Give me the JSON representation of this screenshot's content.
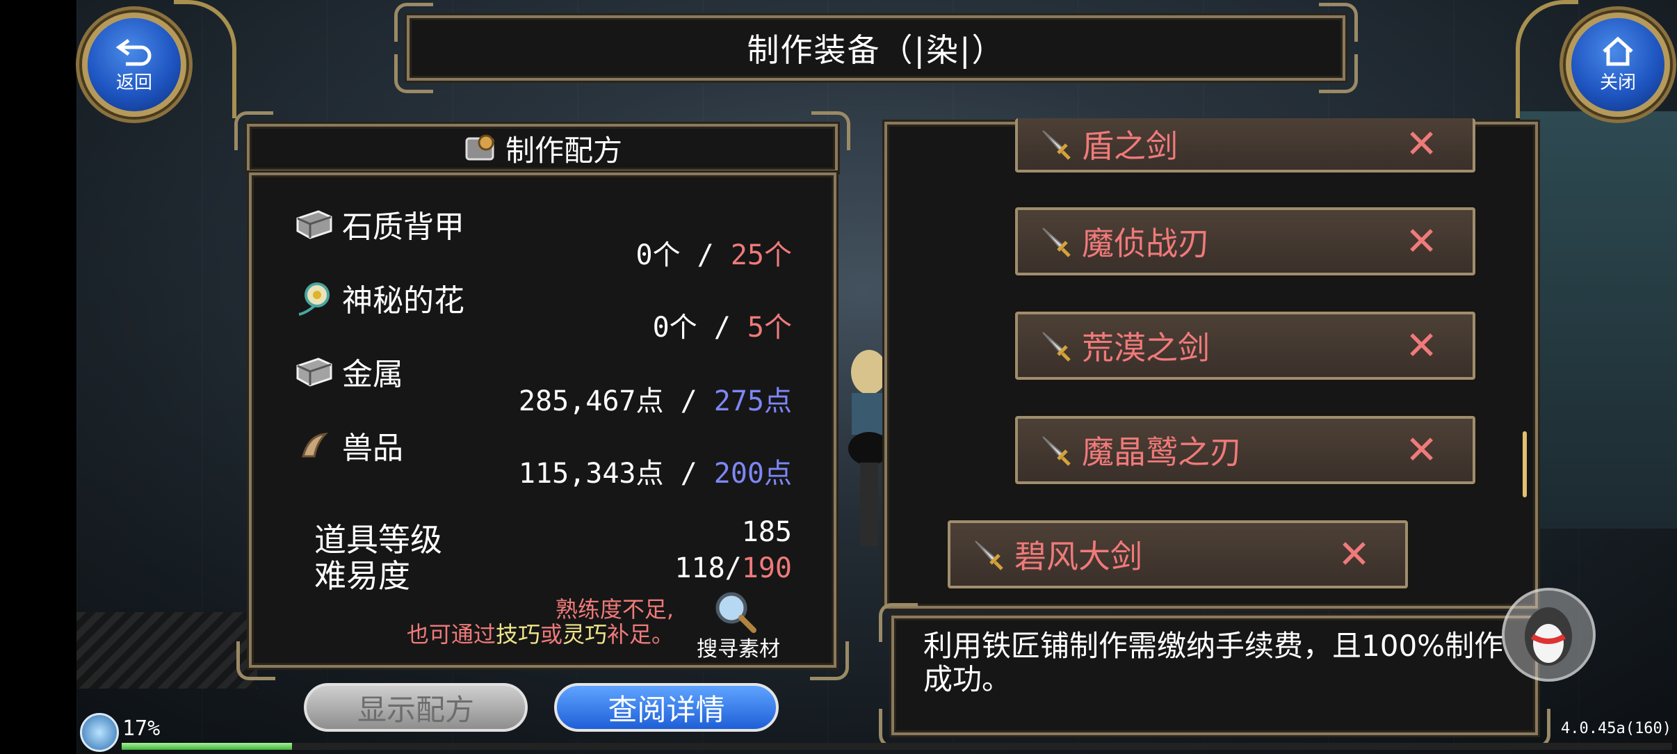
{
  "title": "制作装备（|染|）",
  "buttons": {
    "back": {
      "label": "返回",
      "icon": "back-arrow-icon"
    },
    "close": {
      "label": "关闭",
      "icon": "home-icon"
    },
    "show_recipe": "显示配方",
    "view_detail": "查阅详情",
    "search_material": "搜寻素材"
  },
  "recipe": {
    "header": "制作配方",
    "materials": [
      {
        "name": "石质背甲",
        "icon": "stone-shell-icon",
        "have": "0个",
        "sep": " / ",
        "need": "25个",
        "need_color": "red"
      },
      {
        "name": "神秘的花",
        "icon": "flower-icon",
        "have": "0个",
        "sep": " / ",
        "need": "5个",
        "need_color": "red"
      },
      {
        "name": "金属",
        "icon": "metal-icon",
        "have": "285,467点",
        "sep": " / ",
        "need": "275点",
        "need_color": "blue"
      },
      {
        "name": "兽品",
        "icon": "claw-icon",
        "have": "115,343点",
        "sep": " / ",
        "need": "200点",
        "need_color": "blue"
      }
    ],
    "item_level_label": "道具等级",
    "item_level_value": "185",
    "difficulty_label": "难易度",
    "difficulty_have": "118/",
    "difficulty_need": "190",
    "warning_line1": "熟练度不足,",
    "warning_line2_pre": "也可通过",
    "warning_line2_hl1": "技巧",
    "warning_line2_mid": "或",
    "warning_line2_hl2": "灵巧",
    "warning_line2_post": "补足。"
  },
  "equipment_list": [
    {
      "name": "盾之剑",
      "remove": "✕"
    },
    {
      "name": "魔侦战刃",
      "remove": "✕"
    },
    {
      "name": "荒漠之剑",
      "remove": "✕"
    },
    {
      "name": "魔晶鹫之刃",
      "remove": "✕"
    },
    {
      "name": "碧风大剑",
      "remove": "✕"
    }
  ],
  "info_text": "利用铁匠铺制作需缴纳手续费，且100%制作成功。",
  "status": {
    "exp_percent": "17%",
    "exp_fraction": 0.11,
    "version": "4.0.45a(160)"
  },
  "colors": {
    "red": "#f07a7a",
    "blue": "#7e87f5",
    "yellow": "#f0e68a",
    "gold_border": "#9b8a66"
  }
}
